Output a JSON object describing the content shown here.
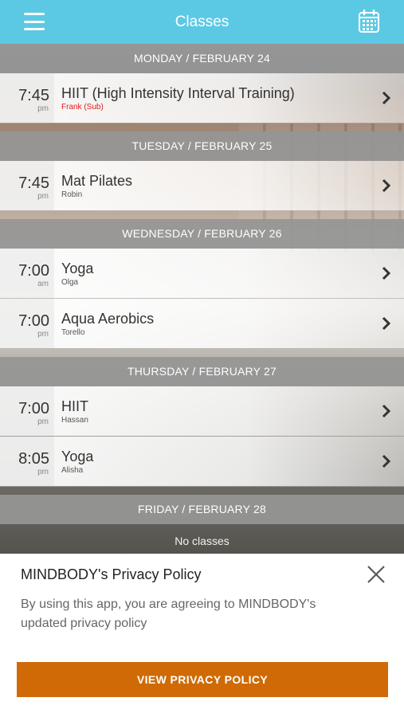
{
  "header": {
    "title": "Classes",
    "menu_icon": "hamburger-menu-icon",
    "calendar_icon": "calendar-icon",
    "bar_color": "#5cc9e4"
  },
  "days": [
    {
      "label": "MONDAY / FEBRUARY 24",
      "classes": [
        {
          "time": "7:45",
          "ampm": "pm",
          "name": "HIIT (High Intensity Interval Training)",
          "instructor": "Frank (Sub)",
          "substitute": true
        }
      ]
    },
    {
      "label": "TUESDAY / FEBRUARY 25",
      "classes": [
        {
          "time": "7:45",
          "ampm": "pm",
          "name": "Mat Pilates",
          "instructor": "Robin"
        }
      ]
    },
    {
      "label": "WEDNESDAY / FEBRUARY 26",
      "classes": [
        {
          "time": "7:00",
          "ampm": "am",
          "name": "Yoga",
          "instructor": "Olga"
        },
        {
          "time": "7:00",
          "ampm": "pm",
          "name": "Aqua Aerobics",
          "instructor": "Torello"
        }
      ]
    },
    {
      "label": "THURSDAY / FEBRUARY 27",
      "classes": [
        {
          "time": "7:00",
          "ampm": "pm",
          "name": "HIIT",
          "instructor": "Hassan"
        },
        {
          "time": "8:05",
          "ampm": "pm",
          "name": "Yoga",
          "instructor": "Alisha"
        }
      ]
    },
    {
      "label": "FRIDAY / FEBRUARY 28",
      "empty_text": "No classes"
    }
  ],
  "privacy": {
    "title": "MINDBODY's Privacy Policy",
    "body": "By using this app, you are agreeing to MINDBODY's updated privacy policy",
    "button_label": "VIEW PRIVACY POLICY",
    "button_color": "#cf6a06",
    "close_icon": "close-icon"
  }
}
